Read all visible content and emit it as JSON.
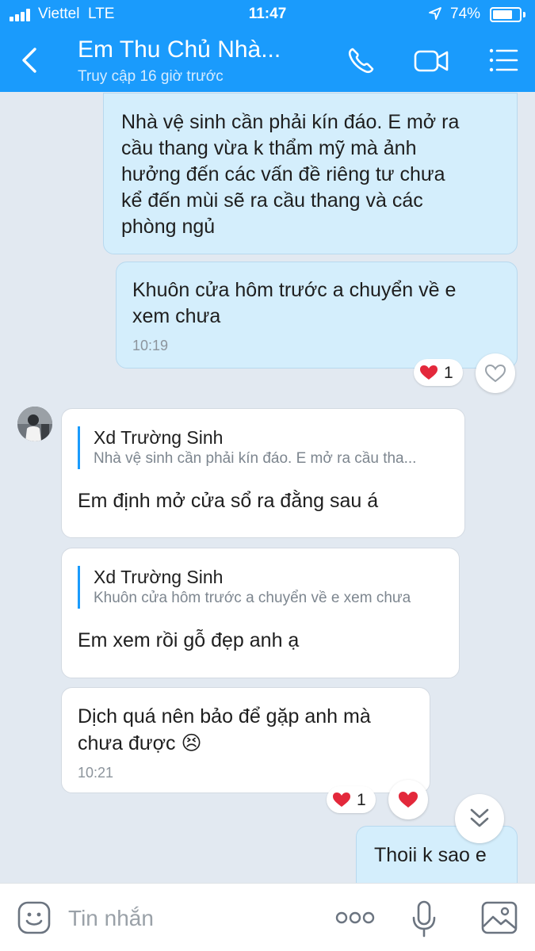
{
  "status_bar": {
    "carrier": "Viettel",
    "network": "LTE",
    "time": "11:47",
    "battery": "74%",
    "battery_level": 0.74
  },
  "header": {
    "title": "Em Thu Chủ Nhà...",
    "subtitle": "Truy cập 16 giờ trước",
    "color": "#1a9bfc"
  },
  "icons": {
    "back": "chevron-left-icon",
    "call": "phone-icon",
    "video": "video-camera-icon",
    "menu": "menu-list-icon",
    "sticker": "sticker-icon",
    "more": "more-dots-icon",
    "mic": "microphone-icon",
    "image": "image-icon",
    "scroll": "scroll-down-icon",
    "heart": "heart-icon"
  },
  "messages": [
    {
      "id": "m1",
      "direction": "out",
      "text": "Nhà vệ sinh cần phải kín đáo. E mở ra\ncầu thang vừa k thẩm mỹ mà ảnh\nhưởng đến các vấn đề riêng tư chưa\nkể đến mùi sẽ ra cầu thang và các\nphòng ngủ"
    },
    {
      "id": "m2",
      "direction": "out",
      "text": "Khuôn cửa hôm trước a chuyển về e\nxem chưa",
      "time": "10:19",
      "reaction_count": "1"
    },
    {
      "id": "m3",
      "direction": "in",
      "quote_name": "Xd Trường Sinh",
      "quote_text": "Nhà vệ sinh cần phải kín đáo. E mở ra cầu tha...",
      "text": "Em định mở cửa sổ ra đằng sau á"
    },
    {
      "id": "m4",
      "direction": "in",
      "quote_name": "Xd Trường Sinh",
      "quote_text": "Khuôn cửa hôm trước a chuyển về e xem chưa",
      "text": "Em xem rồi gỗ đẹp anh ạ"
    },
    {
      "id": "m5",
      "direction": "in",
      "text": "Dịch quá nên bảo để gặp anh mà\nchưa được",
      "emoji": "😣",
      "time": "10:21",
      "reaction_count": "1"
    },
    {
      "id": "m6",
      "direction": "out",
      "text": "Thoii k sao e"
    }
  ],
  "input": {
    "placeholder": "Tin nhắn"
  }
}
